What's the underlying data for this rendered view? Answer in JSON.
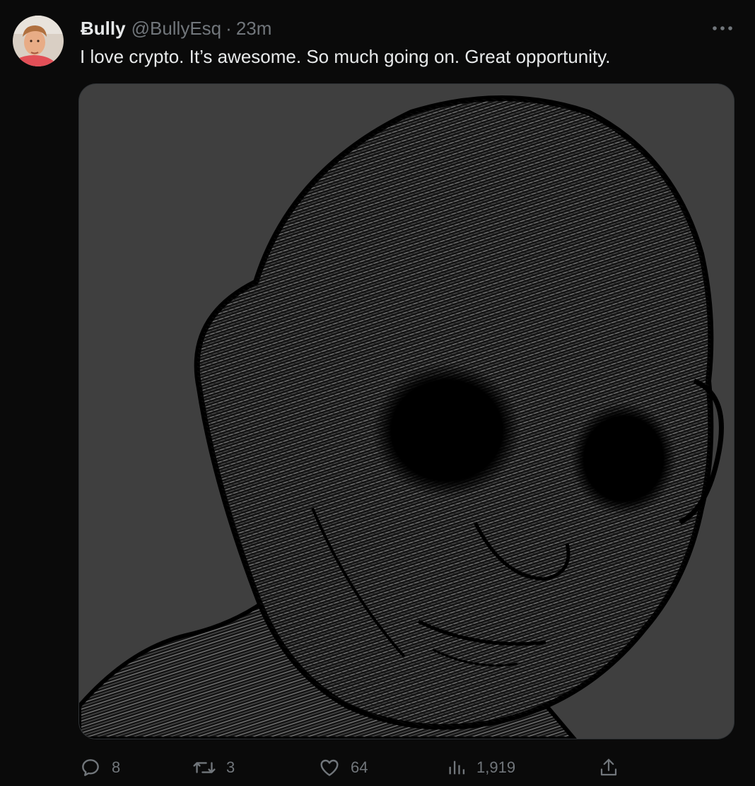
{
  "tweet": {
    "display_name": "Ƀully",
    "handle": "@BullyEsq",
    "separator": "·",
    "time": "23m",
    "text": "I love crypto. It’s awesome. So much going on. Great opportunity."
  },
  "media": {
    "description_icon": "wojak-sketch-image"
  },
  "actions": {
    "reply_count": "8",
    "retweet_count": "3",
    "like_count": "64",
    "view_count": "1,919"
  },
  "colors": {
    "background": "#0a0a0a",
    "primary_text": "#e7e9ea",
    "secondary_text": "#71767b",
    "image_background": "#3f3f3f"
  },
  "icons": {
    "more": "more-options-icon",
    "reply": "reply-icon",
    "retweet": "retweet-icon",
    "like": "like-icon",
    "views": "views-icon",
    "share": "share-icon"
  }
}
